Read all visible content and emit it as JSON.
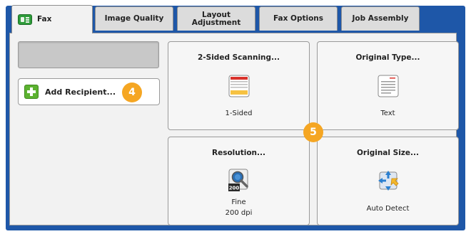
{
  "tabs": [
    {
      "label": "Fax",
      "active": true
    },
    {
      "label": "Image Quality",
      "active": false
    },
    {
      "label": "Layout Adjustment",
      "active": false
    },
    {
      "label": "Fax Options",
      "active": false
    },
    {
      "label": "Job Assembly",
      "active": false
    }
  ],
  "recipient_field": {
    "value": ""
  },
  "add_recipient": {
    "label": "Add Recipient..."
  },
  "callouts": {
    "first": "4",
    "second": "5"
  },
  "tiles": {
    "two_sided": {
      "title": "2-Sided Scanning...",
      "value": "1-Sided",
      "icon": "one-sided-document-icon"
    },
    "original_type": {
      "title": "Original Type...",
      "value": "Text",
      "icon": "text-document-icon"
    },
    "resolution": {
      "title": "Resolution...",
      "value_line1": "Fine",
      "value_line2": "200 dpi",
      "icon_badge": "200",
      "icon": "resolution-magnifier-icon"
    },
    "original_size": {
      "title": "Original Size...",
      "value": "Auto Detect",
      "icon": "auto-detect-size-icon"
    }
  },
  "colors": {
    "frame": "#1e57a8",
    "panel": "#f2f2f2",
    "callout": "#f5a623",
    "accent_green": "#5cb230"
  }
}
